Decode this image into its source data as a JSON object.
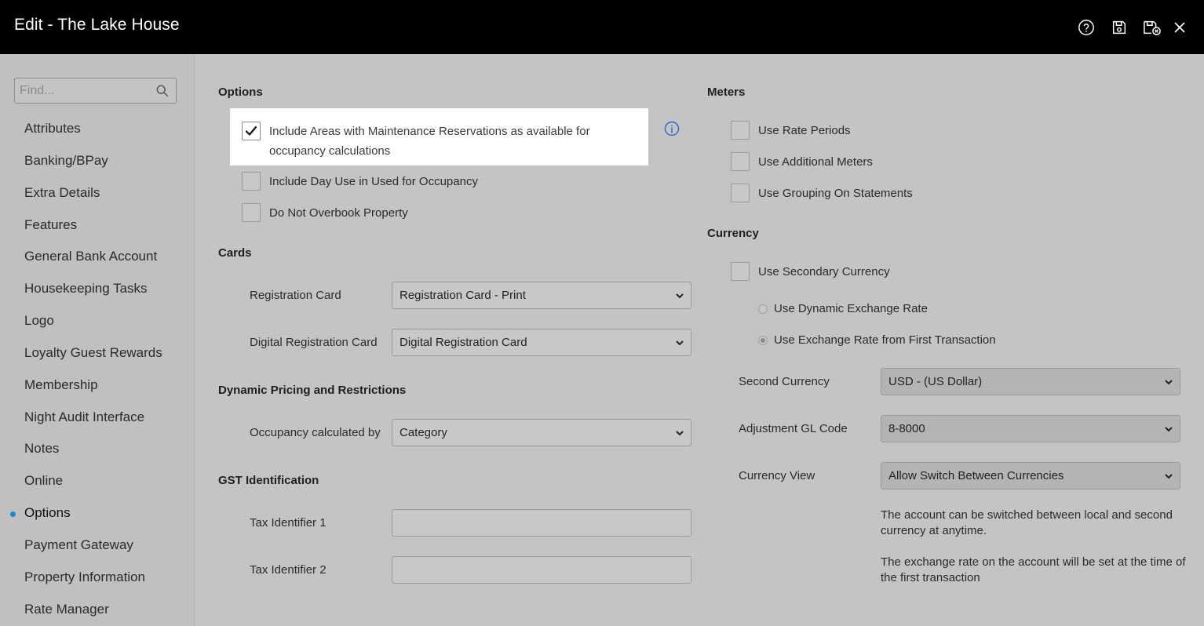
{
  "window": {
    "title": "Edit - The Lake House",
    "icons": [
      "help-icon",
      "save-icon",
      "save-exit-icon",
      "close-icon"
    ]
  },
  "sidebar": {
    "search_placeholder": "Find...",
    "items": [
      {
        "label": "Attributes"
      },
      {
        "label": "Banking/BPay"
      },
      {
        "label": "Extra Details"
      },
      {
        "label": "Features"
      },
      {
        "label": "General Bank Account"
      },
      {
        "label": "Housekeeping Tasks"
      },
      {
        "label": "Logo"
      },
      {
        "label": "Loyalty Guest Rewards"
      },
      {
        "label": "Membership"
      },
      {
        "label": "Night Audit Interface"
      },
      {
        "label": "Notes"
      },
      {
        "label": "Online"
      },
      {
        "label": "Options",
        "active": true
      },
      {
        "label": "Payment Gateway"
      },
      {
        "label": "Property Information"
      },
      {
        "label": "Rate Manager"
      }
    ]
  },
  "options": {
    "title": "Options",
    "include_maintenance": {
      "label": "Include Areas with Maintenance Reservations as available for occupancy calculations",
      "checked": true
    },
    "include_day_use": {
      "label": "Include Day Use in Used for Occupancy",
      "checked": false
    },
    "do_not_overbook": {
      "label": "Do Not Overbook Property",
      "checked": false
    }
  },
  "cards": {
    "title": "Cards",
    "registration_card": {
      "label": "Registration Card",
      "value": "Registration Card - Print"
    },
    "digital_registration_card": {
      "label": "Digital Registration Card",
      "value": "Digital Registration Card"
    }
  },
  "dynamic_pricing": {
    "title": "Dynamic Pricing and Restrictions",
    "occupancy_by": {
      "label": "Occupancy calculated by",
      "value": "Category"
    }
  },
  "gst": {
    "title": "GST Identification",
    "tax_identifier_1": {
      "label": "Tax Identifier 1",
      "value": ""
    },
    "tax_identifier_2": {
      "label": "Tax Identifier 2",
      "value": ""
    }
  },
  "meters": {
    "title": "Meters",
    "use_rate_periods": {
      "label": "Use Rate Periods",
      "checked": false
    },
    "use_additional_meters": {
      "label": "Use Additional Meters",
      "checked": false
    },
    "use_grouping": {
      "label": "Use Grouping On Statements",
      "checked": false
    }
  },
  "currency": {
    "title": "Currency",
    "use_secondary": {
      "label": "Use Secondary Currency",
      "checked": false
    },
    "dynamic_rate": {
      "label": "Use Dynamic Exchange Rate",
      "selected": false
    },
    "first_transaction_rate": {
      "label": "Use Exchange Rate from First Transaction",
      "selected": true
    },
    "second_currency": {
      "label": "Second Currency",
      "value": "USD - (US Dollar)"
    },
    "adjustment_gl": {
      "label": "Adjustment GL Code",
      "value": "8-8000"
    },
    "currency_view": {
      "label": "Currency View",
      "value": "Allow Switch Between Currencies"
    },
    "note_1": "The account can be switched between local and second currency at anytime.",
    "note_2": "The exchange rate on the account will be set at the time of the first transaction"
  },
  "colors": {
    "titlebar": "#000000",
    "background": "#c4c4c4",
    "accent_dot": "#1a86c8",
    "info_icon": "#2a6fd0"
  }
}
